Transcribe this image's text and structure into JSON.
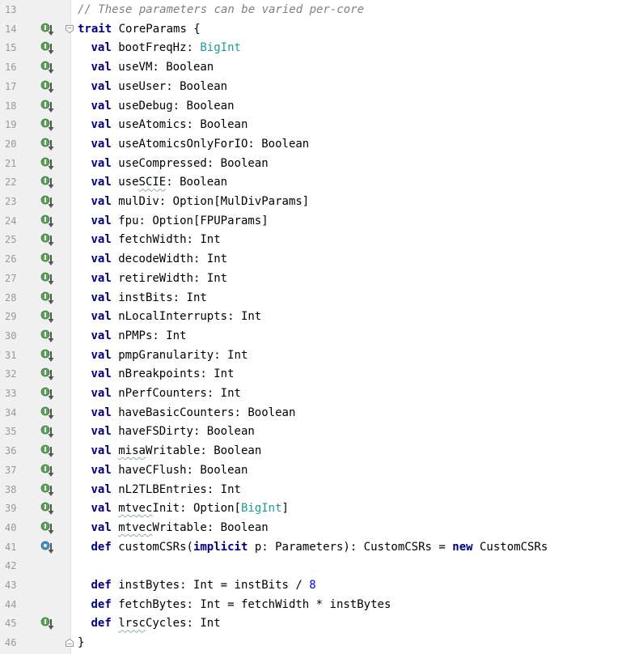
{
  "editor": {
    "colors": {
      "keyword": "#000080",
      "type": "#20999d",
      "comment": "#808080",
      "number": "#0000ff",
      "line_number": "#999999",
      "gutter_bg": "#f0f0f0",
      "implement_marker": "#5aa05a",
      "override_marker": "#3d8fc6"
    },
    "lines": [
      {
        "n": "13",
        "indent": 0,
        "marker": "",
        "fold": "",
        "tokens": [
          {
            "t": "// These parameters can be varied per-core",
            "c": "cm"
          }
        ]
      },
      {
        "n": "14",
        "indent": 0,
        "marker": "implemented-icon",
        "fold": "fold-open-icon",
        "tokens": [
          {
            "t": "trait",
            "c": "kw"
          },
          {
            "t": " CoreParams {",
            "c": "plain"
          }
        ]
      },
      {
        "n": "15",
        "indent": 1,
        "marker": "implemented-icon",
        "fold": "",
        "tokens": [
          {
            "t": "val",
            "c": "kw"
          },
          {
            "t": " bootFreqHz: ",
            "c": "plain"
          },
          {
            "t": "BigInt",
            "c": "type"
          }
        ]
      },
      {
        "n": "16",
        "indent": 1,
        "marker": "implemented-icon",
        "fold": "",
        "tokens": [
          {
            "t": "val",
            "c": "kw"
          },
          {
            "t": " useVM: Boolean",
            "c": "plain"
          }
        ]
      },
      {
        "n": "17",
        "indent": 1,
        "marker": "implemented-icon",
        "fold": "",
        "tokens": [
          {
            "t": "val",
            "c": "kw"
          },
          {
            "t": " useUser: Boolean",
            "c": "plain"
          }
        ]
      },
      {
        "n": "18",
        "indent": 1,
        "marker": "implemented-icon",
        "fold": "",
        "tokens": [
          {
            "t": "val",
            "c": "kw"
          },
          {
            "t": " useDebug: Boolean",
            "c": "plain"
          }
        ]
      },
      {
        "n": "19",
        "indent": 1,
        "marker": "implemented-icon",
        "fold": "",
        "tokens": [
          {
            "t": "val",
            "c": "kw"
          },
          {
            "t": " useAtomics: Boolean",
            "c": "plain"
          }
        ]
      },
      {
        "n": "20",
        "indent": 1,
        "marker": "implemented-icon",
        "fold": "",
        "tokens": [
          {
            "t": "val",
            "c": "kw"
          },
          {
            "t": " useAtomicsOnlyForIO: Boolean",
            "c": "plain"
          }
        ]
      },
      {
        "n": "21",
        "indent": 1,
        "marker": "implemented-icon",
        "fold": "",
        "tokens": [
          {
            "t": "val",
            "c": "kw"
          },
          {
            "t": " useCompressed: Boolean",
            "c": "plain"
          }
        ]
      },
      {
        "n": "22",
        "indent": 1,
        "marker": "implemented-icon",
        "fold": "",
        "tokens": [
          {
            "t": "val",
            "c": "kw"
          },
          {
            "t": " use",
            "c": "plain"
          },
          {
            "t": "SCIE",
            "c": "squig"
          },
          {
            "t": ": Boolean",
            "c": "plain"
          }
        ]
      },
      {
        "n": "23",
        "indent": 1,
        "marker": "implemented-icon",
        "fold": "",
        "tokens": [
          {
            "t": "val",
            "c": "kw"
          },
          {
            "t": " mulDiv: Option[MulDivParams]",
            "c": "plain"
          }
        ]
      },
      {
        "n": "24",
        "indent": 1,
        "marker": "implemented-icon",
        "fold": "",
        "tokens": [
          {
            "t": "val",
            "c": "kw"
          },
          {
            "t": " fpu: Option[FPUParams]",
            "c": "plain"
          }
        ]
      },
      {
        "n": "25",
        "indent": 1,
        "marker": "implemented-icon",
        "fold": "",
        "tokens": [
          {
            "t": "val",
            "c": "kw"
          },
          {
            "t": " fetchWidth: Int",
            "c": "plain"
          }
        ]
      },
      {
        "n": "26",
        "indent": 1,
        "marker": "implemented-icon",
        "fold": "",
        "tokens": [
          {
            "t": "val",
            "c": "kw"
          },
          {
            "t": " decodeWidth: Int",
            "c": "plain"
          }
        ]
      },
      {
        "n": "27",
        "indent": 1,
        "marker": "implemented-icon",
        "fold": "",
        "tokens": [
          {
            "t": "val",
            "c": "kw"
          },
          {
            "t": " retireWidth: Int",
            "c": "plain"
          }
        ]
      },
      {
        "n": "28",
        "indent": 1,
        "marker": "implemented-icon",
        "fold": "",
        "tokens": [
          {
            "t": "val",
            "c": "kw"
          },
          {
            "t": " instBits: Int",
            "c": "plain"
          }
        ]
      },
      {
        "n": "29",
        "indent": 1,
        "marker": "implemented-icon",
        "fold": "",
        "tokens": [
          {
            "t": "val",
            "c": "kw"
          },
          {
            "t": " nLocalInterrupts: Int",
            "c": "plain"
          }
        ]
      },
      {
        "n": "30",
        "indent": 1,
        "marker": "implemented-icon",
        "fold": "",
        "tokens": [
          {
            "t": "val",
            "c": "kw"
          },
          {
            "t": " nPMPs: Int",
            "c": "plain"
          }
        ]
      },
      {
        "n": "31",
        "indent": 1,
        "marker": "implemented-icon",
        "fold": "",
        "tokens": [
          {
            "t": "val",
            "c": "kw"
          },
          {
            "t": " pmpGranularity: Int",
            "c": "plain"
          }
        ]
      },
      {
        "n": "32",
        "indent": 1,
        "marker": "implemented-icon",
        "fold": "",
        "tokens": [
          {
            "t": "val",
            "c": "kw"
          },
          {
            "t": " nBreakpoints: Int",
            "c": "plain"
          }
        ]
      },
      {
        "n": "33",
        "indent": 1,
        "marker": "implemented-icon",
        "fold": "",
        "tokens": [
          {
            "t": "val",
            "c": "kw"
          },
          {
            "t": " nPerfCounters: Int",
            "c": "plain"
          }
        ]
      },
      {
        "n": "34",
        "indent": 1,
        "marker": "implemented-icon",
        "fold": "",
        "tokens": [
          {
            "t": "val",
            "c": "kw"
          },
          {
            "t": " haveBasicCounters: Boolean",
            "c": "plain"
          }
        ]
      },
      {
        "n": "35",
        "indent": 1,
        "marker": "implemented-icon",
        "fold": "",
        "tokens": [
          {
            "t": "val",
            "c": "kw"
          },
          {
            "t": " haveFSDirty: Boolean",
            "c": "plain"
          }
        ]
      },
      {
        "n": "36",
        "indent": 1,
        "marker": "implemented-icon",
        "fold": "",
        "tokens": [
          {
            "t": "val",
            "c": "kw"
          },
          {
            "t": " ",
            "c": "plain"
          },
          {
            "t": "misa",
            "c": "squig"
          },
          {
            "t": "Writable: Boolean",
            "c": "plain"
          }
        ]
      },
      {
        "n": "37",
        "indent": 1,
        "marker": "implemented-icon",
        "fold": "",
        "tokens": [
          {
            "t": "val",
            "c": "kw"
          },
          {
            "t": " haveCFlush: Boolean",
            "c": "plain"
          }
        ]
      },
      {
        "n": "38",
        "indent": 1,
        "marker": "implemented-icon",
        "fold": "",
        "tokens": [
          {
            "t": "val",
            "c": "kw"
          },
          {
            "t": " nL2TLBEntries: Int",
            "c": "plain"
          }
        ]
      },
      {
        "n": "39",
        "indent": 1,
        "marker": "implemented-icon",
        "fold": "",
        "tokens": [
          {
            "t": "val",
            "c": "kw"
          },
          {
            "t": " ",
            "c": "plain"
          },
          {
            "t": "mtvec",
            "c": "squig"
          },
          {
            "t": "Init: Option[",
            "c": "plain"
          },
          {
            "t": "BigInt",
            "c": "type"
          },
          {
            "t": "]",
            "c": "plain"
          }
        ]
      },
      {
        "n": "40",
        "indent": 1,
        "marker": "implemented-icon",
        "fold": "",
        "tokens": [
          {
            "t": "val",
            "c": "kw"
          },
          {
            "t": " ",
            "c": "plain"
          },
          {
            "t": "mtvec",
            "c": "squig"
          },
          {
            "t": "Writable: Boolean",
            "c": "plain"
          }
        ]
      },
      {
        "n": "41",
        "indent": 1,
        "marker": "overridden-icon",
        "fold": "",
        "tokens": [
          {
            "t": "def",
            "c": "kw"
          },
          {
            "t": " customCSRs(",
            "c": "plain"
          },
          {
            "t": "implicit",
            "c": "kw"
          },
          {
            "t": " p: Parameters): CustomCSRs = ",
            "c": "plain"
          },
          {
            "t": "new",
            "c": "kw"
          },
          {
            "t": " CustomCSRs",
            "c": "plain"
          }
        ]
      },
      {
        "n": "42",
        "indent": 0,
        "marker": "",
        "fold": "",
        "tokens": []
      },
      {
        "n": "43",
        "indent": 1,
        "marker": "",
        "fold": "",
        "tokens": [
          {
            "t": "def",
            "c": "kw"
          },
          {
            "t": " instBytes: Int = instBits / ",
            "c": "plain"
          },
          {
            "t": "8",
            "c": "num"
          }
        ]
      },
      {
        "n": "44",
        "indent": 1,
        "marker": "",
        "fold": "",
        "tokens": [
          {
            "t": "def",
            "c": "kw"
          },
          {
            "t": " fetchBytes: Int = fetchWidth * instBytes",
            "c": "plain"
          }
        ]
      },
      {
        "n": "45",
        "indent": 1,
        "marker": "implemented-icon",
        "fold": "",
        "tokens": [
          {
            "t": "def",
            "c": "kw"
          },
          {
            "t": " ",
            "c": "plain"
          },
          {
            "t": "lrsc",
            "c": "squig"
          },
          {
            "t": "Cycles: Int",
            "c": "plain"
          }
        ]
      },
      {
        "n": "46",
        "indent": 0,
        "marker": "",
        "fold": "fold-close-icon",
        "tokens": [
          {
            "t": "}",
            "c": "plain"
          }
        ]
      }
    ]
  }
}
